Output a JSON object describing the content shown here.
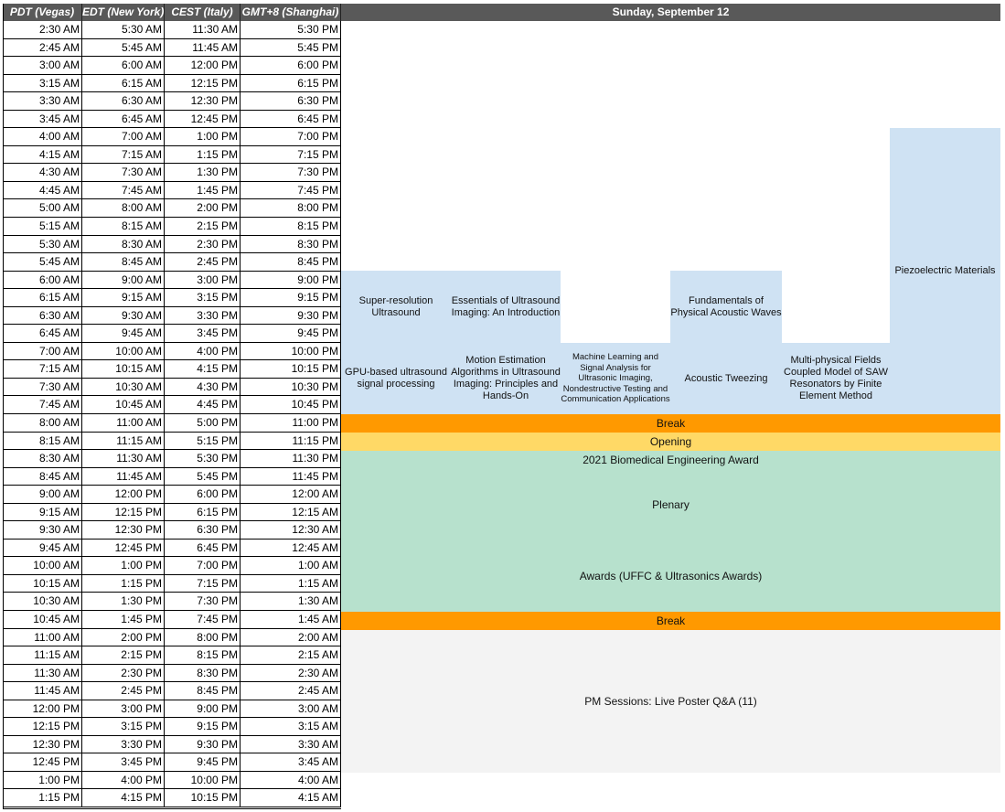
{
  "header": {
    "columns": [
      "PDT (Vegas)",
      "EDT (New York)",
      "CEST (Italy)",
      "GMT+8 (Shanghai)"
    ],
    "date": "Sunday, September 12"
  },
  "rows": [
    [
      "2:30 AM",
      "5:30 AM",
      "11:30 AM",
      "5:30 PM"
    ],
    [
      "2:45 AM",
      "5:45 AM",
      "11:45 AM",
      "5:45 PM"
    ],
    [
      "3:00 AM",
      "6:00 AM",
      "12:00 PM",
      "6:00 PM"
    ],
    [
      "3:15 AM",
      "6:15 AM",
      "12:15 PM",
      "6:15 PM"
    ],
    [
      "3:30 AM",
      "6:30 AM",
      "12:30 PM",
      "6:30 PM"
    ],
    [
      "3:45 AM",
      "6:45 AM",
      "12:45 PM",
      "6:45 PM"
    ],
    [
      "4:00 AM",
      "7:00 AM",
      "1:00 PM",
      "7:00 PM"
    ],
    [
      "4:15 AM",
      "7:15 AM",
      "1:15 PM",
      "7:15 PM"
    ],
    [
      "4:30 AM",
      "7:30 AM",
      "1:30 PM",
      "7:30 PM"
    ],
    [
      "4:45 AM",
      "7:45 AM",
      "1:45 PM",
      "7:45 PM"
    ],
    [
      "5:00 AM",
      "8:00 AM",
      "2:00 PM",
      "8:00 PM"
    ],
    [
      "5:15 AM",
      "8:15 AM",
      "2:15 PM",
      "8:15 PM"
    ],
    [
      "5:30 AM",
      "8:30 AM",
      "2:30 PM",
      "8:30 PM"
    ],
    [
      "5:45 AM",
      "8:45 AM",
      "2:45 PM",
      "8:45 PM"
    ],
    [
      "6:00 AM",
      "9:00 AM",
      "3:00 PM",
      "9:00 PM"
    ],
    [
      "6:15 AM",
      "9:15 AM",
      "3:15 PM",
      "9:15 PM"
    ],
    [
      "6:30 AM",
      "9:30 AM",
      "3:30 PM",
      "9:30 PM"
    ],
    [
      "6:45 AM",
      "9:45 AM",
      "3:45 PM",
      "9:45 PM"
    ],
    [
      "7:00 AM",
      "10:00 AM",
      "4:00 PM",
      "10:00 PM"
    ],
    [
      "7:15 AM",
      "10:15 AM",
      "4:15 PM",
      "10:15 PM"
    ],
    [
      "7:30 AM",
      "10:30 AM",
      "4:30 PM",
      "10:30 PM"
    ],
    [
      "7:45 AM",
      "10:45 AM",
      "4:45 PM",
      "10:45 PM"
    ],
    [
      "8:00 AM",
      "11:00 AM",
      "5:00 PM",
      "11:00 PM"
    ],
    [
      "8:15 AM",
      "11:15 AM",
      "5:15 PM",
      "11:15 PM"
    ],
    [
      "8:30 AM",
      "11:30 AM",
      "5:30 PM",
      "11:30 PM"
    ],
    [
      "8:45 AM",
      "11:45 AM",
      "5:45 PM",
      "11:45 PM"
    ],
    [
      "9:00 AM",
      "12:00 PM",
      "6:00 PM",
      "12:00 AM"
    ],
    [
      "9:15 AM",
      "12:15 PM",
      "6:15 PM",
      "12:15 AM"
    ],
    [
      "9:30 AM",
      "12:30 PM",
      "6:30 PM",
      "12:30 AM"
    ],
    [
      "9:45 AM",
      "12:45 PM",
      "6:45 PM",
      "12:45 AM"
    ],
    [
      "10:00 AM",
      "1:00 PM",
      "7:00 PM",
      "1:00 AM"
    ],
    [
      "10:15 AM",
      "1:15 PM",
      "7:15 PM",
      "1:15 AM"
    ],
    [
      "10:30 AM",
      "1:30 PM",
      "7:30 PM",
      "1:30 AM"
    ],
    [
      "10:45 AM",
      "1:45 PM",
      "7:45 PM",
      "1:45 AM"
    ],
    [
      "11:00 AM",
      "2:00 PM",
      "8:00 PM",
      "2:00 AM"
    ],
    [
      "11:15 AM",
      "2:15 PM",
      "8:15 PM",
      "2:15 AM"
    ],
    [
      "11:30 AM",
      "2:30 PM",
      "8:30 PM",
      "2:30 AM"
    ],
    [
      "11:45 AM",
      "2:45 PM",
      "8:45 PM",
      "2:45 AM"
    ],
    [
      "12:00 PM",
      "3:00 PM",
      "9:00 PM",
      "3:00 AM"
    ],
    [
      "12:15 PM",
      "3:15 PM",
      "9:15 PM",
      "3:15 AM"
    ],
    [
      "12:30 PM",
      "3:30 PM",
      "9:30 PM",
      "3:30 AM"
    ],
    [
      "12:45 PM",
      "3:45 PM",
      "9:45 PM",
      "3:45 AM"
    ],
    [
      "1:00 PM",
      "4:00 PM",
      "10:00 PM",
      "4:00 AM"
    ],
    [
      "1:15 PM",
      "4:15 PM",
      "10:15 PM",
      "4:15 AM"
    ]
  ],
  "sessions": {
    "super_resolution": "Super-resolution Ultrasound",
    "essentials": "Essentials of Ultrasound Imaging: An Introduction",
    "fundamentals": "Fundamentals of Physical Acoustic Waves",
    "piezoelectric": "Piezoelectric Materials",
    "gpu": "GPU-based ultrasound signal processing",
    "motion": "Motion Estimation Algorithms in Ultrasound Imaging: Principles and Hands-On",
    "machine_learning": "Machine Learning and Signal Analysis for Ultrasonic Imaging, Nondestructive Testing and Communication Applications",
    "tweezing": "Acoustic Tweezing",
    "multiphysical": "Multi-physical Fields Coupled Model of SAW Resonators by Finite Element Method",
    "break1": "Break",
    "opening": "Opening",
    "award": "2021 Biomedical Engineering Award",
    "plenary": "Plenary",
    "awards": "Awards (UFFC & Ultrasonics Awards)",
    "break2": "Break",
    "pm": "PM Sessions: Live Poster Q&A (11)"
  },
  "colors": {
    "header": "#595959",
    "tutorial": "#cfe2f3",
    "plenary": "#b7e1cd",
    "break": "#ff9900",
    "opening": "#ffd966",
    "poster": "#f3f3f3"
  }
}
